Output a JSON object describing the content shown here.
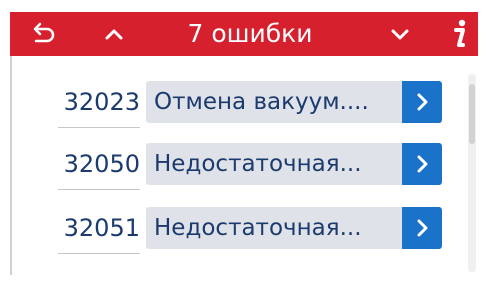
{
  "header": {
    "title": "7 ошибки",
    "background_color": "#d7202e",
    "buttons": {
      "back": "undo-arrow-icon",
      "previous": "chevron-up-icon",
      "next": "chevron-down-icon",
      "info": "info-icon"
    }
  },
  "errors": [
    {
      "code": "32023",
      "description": "Отмена вакуум...."
    },
    {
      "code": "32050",
      "description": "Недостаточная..."
    },
    {
      "code": "32051",
      "description": "Недостаточная..."
    }
  ],
  "colors": {
    "code_text": "#1b3a6e",
    "row_background": "#dfe3e9",
    "detail_button": "#1a73c8"
  }
}
